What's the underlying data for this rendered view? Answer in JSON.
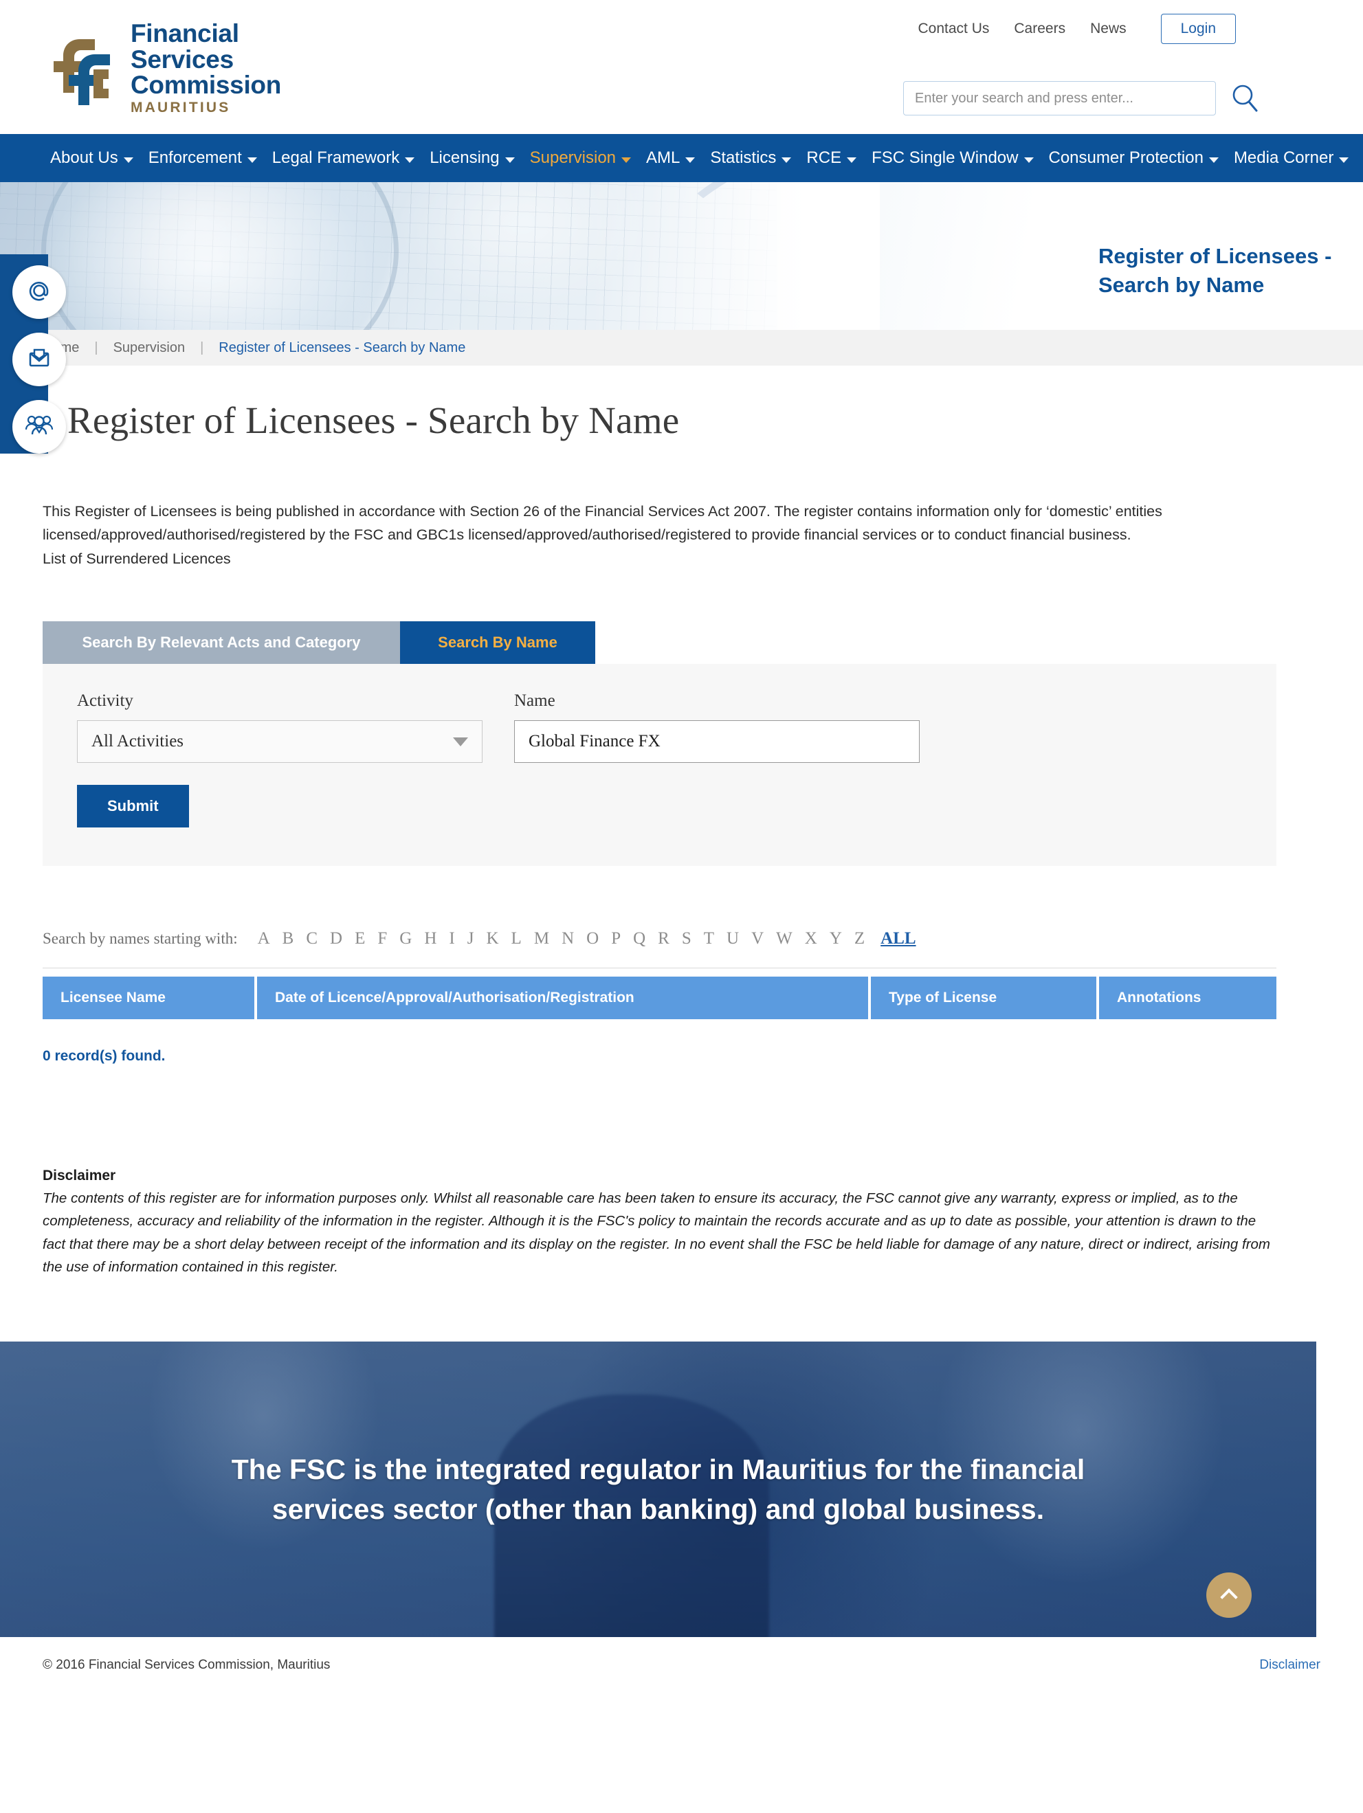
{
  "brand": {
    "line1": "Financial",
    "line2": "Services",
    "line3": "Commission",
    "line4": "MAURITIUS",
    "logo_blue": "#114b82",
    "logo_gold": "#8a7043"
  },
  "topbar": {
    "links": [
      {
        "label": "Contact Us"
      },
      {
        "label": "Careers"
      },
      {
        "label": "News"
      }
    ],
    "login_label": "Login"
  },
  "search": {
    "placeholder": "Enter your search and press enter...",
    "value": ""
  },
  "nav": {
    "items": [
      {
        "label": "About Us",
        "caret": true,
        "active": false
      },
      {
        "label": "Enforcement",
        "caret": true,
        "active": false
      },
      {
        "label": "Legal Framework",
        "caret": true,
        "active": false
      },
      {
        "label": "Licensing",
        "caret": true,
        "active": false
      },
      {
        "label": "Supervision",
        "caret": true,
        "active": true
      },
      {
        "label": "AML",
        "caret": true,
        "active": false
      },
      {
        "label": "Statistics",
        "caret": true,
        "active": false
      },
      {
        "label": "RCE",
        "caret": true,
        "active": false
      },
      {
        "label": "FSC Single Window",
        "caret": true,
        "active": false
      },
      {
        "label": "Consumer Protection",
        "caret": true,
        "active": false
      },
      {
        "label": "Media Corner",
        "caret": true,
        "active": false
      }
    ],
    "active_color": "#f0a93c",
    "bar_color": "#0c5298"
  },
  "social_rail": {
    "items": [
      {
        "icon": "at-sign-icon"
      },
      {
        "icon": "envelope-icon"
      },
      {
        "icon": "people-group-icon"
      }
    ]
  },
  "hero": {
    "title": "Register of Licensees - Search by Name"
  },
  "breadcrumb": {
    "home": "Home",
    "section": "Supervision",
    "current": "Register of Licensees - Search by Name",
    "separator": "|"
  },
  "page": {
    "title": "Register of Licensees - Search by Name",
    "intro_line1": "This Register of Licensees is being published in accordance with Section 26 of the Financial Services Act 2007. The register contains information only for ‘domestic’ entities",
    "intro_line2": "licensed/approved/authorised/registered by the FSC and GBC1s licensed/approved/authorised/registered to provide financial services or to conduct financial business.",
    "intro_line3": "List of Surrendered Licences"
  },
  "tabs": [
    {
      "label": "Search By Relevant Acts and Category",
      "active": false
    },
    {
      "label": "Search By Name",
      "active": true
    }
  ],
  "form": {
    "activity_label": "Activity",
    "activity_value": "All Activities",
    "activity_options": [
      "All Activities"
    ],
    "name_label": "Name",
    "name_value": "Global Finance FX",
    "name_placeholder": "",
    "submit_label": "Submit"
  },
  "alphabet": {
    "label": "Search by names starting with:",
    "letters": [
      "A",
      "B",
      "C",
      "D",
      "E",
      "F",
      "G",
      "H",
      "I",
      "J",
      "K",
      "L",
      "M",
      "N",
      "O",
      "P",
      "Q",
      "R",
      "S",
      "T",
      "U",
      "V",
      "W",
      "X",
      "Y",
      "Z"
    ],
    "all_label": "ALL"
  },
  "table": {
    "columns": [
      "Licensee Name",
      "Date of Licence/Approval/Authorisation/Registration",
      "Type of License",
      "Annotations"
    ],
    "rows": [],
    "record_count_text": "0 record(s) found.",
    "header_color": "#5b9bdf"
  },
  "disclaimer": {
    "title": "Disclaimer",
    "body": "The contents of this register are for information purposes only. Whilst all reasonable care has been taken to ensure its accuracy, the FSC cannot give any warranty, express or implied, as to the completeness, accuracy and reliability of the information in the register. Although it is the FSC's policy to maintain the records accurate and as up to date as possible, your attention is drawn to the fact that there may be a short delay between receipt of the information and its display on the register. In no event shall the FSC be held liable for damage of any nature, direct or indirect, arising from the use of information contained in this register."
  },
  "banner": {
    "text": "The FSC is the integrated regulator in Mauritius for the financial services sector (other than banking) and global business.",
    "scroll_top_icon": "chevron-up-icon"
  },
  "footer": {
    "copyright": "© 2016 Financial Services Commission, Mauritius",
    "disclaimer_link": "Disclaimer"
  }
}
